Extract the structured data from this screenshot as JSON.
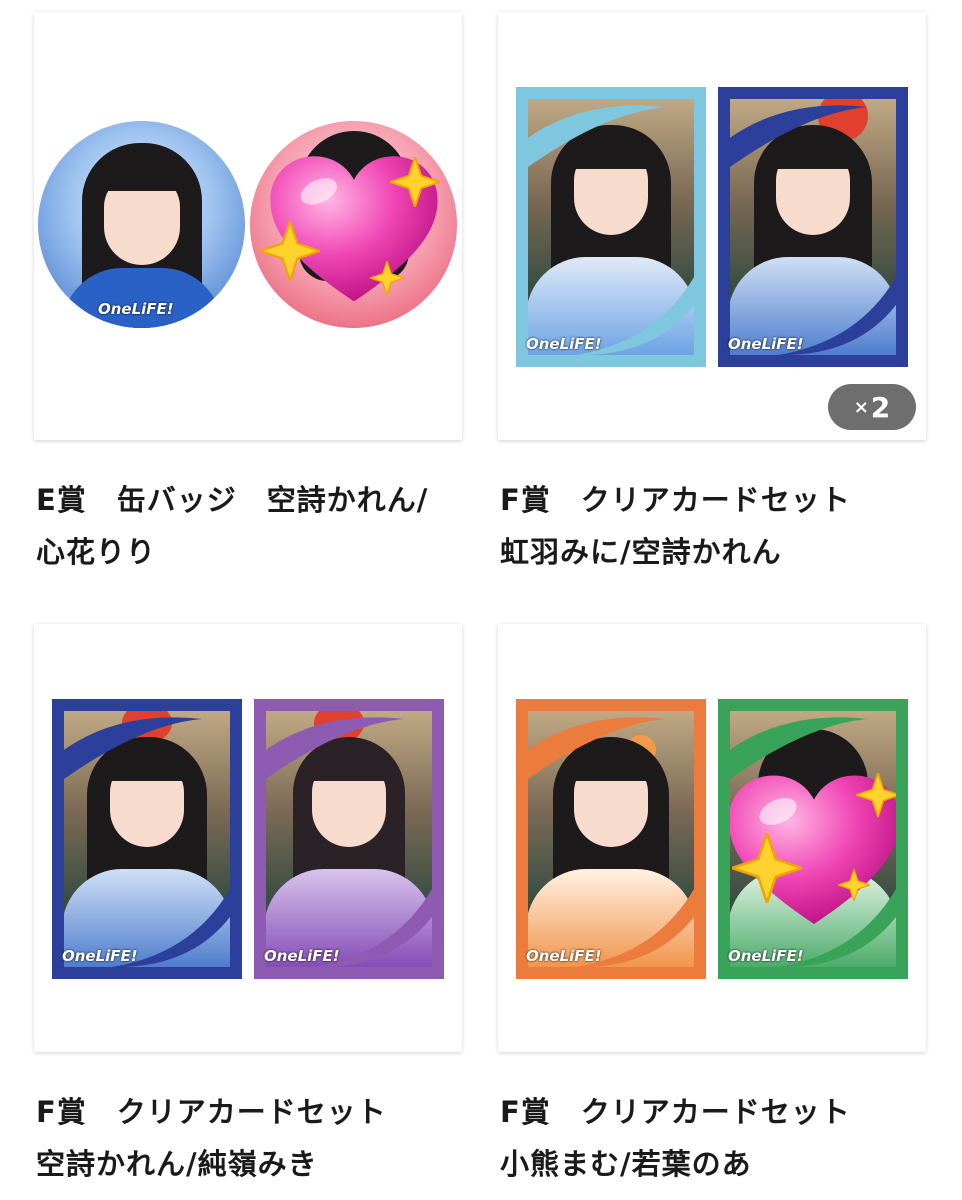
{
  "items": [
    {
      "title": "E賞　缶バッジ　空詩かれん/\n心花りり"
    },
    {
      "title": "F賞　クリアカードセット\n虹羽みに/空詩かれん",
      "quantity": "2",
      "quantity_prefix": "×"
    },
    {
      "title": "F賞　クリアカードセット\n空詩かれん/純嶺みき"
    },
    {
      "title": "F賞　クリアカードセット\n小熊まむ/若葉のあ"
    }
  ],
  "logo_text": "OneLiFE!",
  "colors": {
    "light_blue": "#7fc7df",
    "navy": "#2c3f9a",
    "purple": "#8e5bb2",
    "orange": "#ec7b3e",
    "green": "#3aa35a",
    "badge_gray": "#6e6e6e"
  },
  "icons": [
    "heart-sparkle-icon"
  ]
}
